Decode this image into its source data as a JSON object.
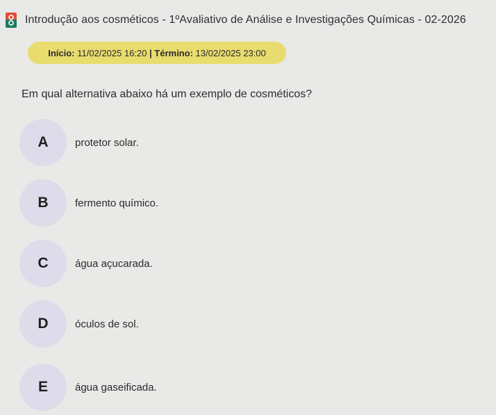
{
  "header": {
    "title": "Introdução aos cosméticos - 1ºAvaliativo de Análise e Investigações Químicas - 02-2026",
    "icon": "app-logo-icon"
  },
  "schedule": {
    "start_label": "Início:",
    "start_value": "11/02/2025 16:20",
    "separator": "|",
    "end_label": "Término:",
    "end_value": "13/02/2025 23:00"
  },
  "question": {
    "text": "Em qual alternativa abaixo há um exemplo de cosméticos?"
  },
  "options": [
    {
      "letter": "A",
      "text": "protetor solar."
    },
    {
      "letter": "B",
      "text": "fermento químico."
    },
    {
      "letter": "C",
      "text": "água açucarada."
    },
    {
      "letter": "D",
      "text": "óculos de sol."
    },
    {
      "letter": "E",
      "text": "água gaseificada."
    }
  ],
  "colors": {
    "background": "#e9e9e7",
    "pill": "#e8dc6e",
    "option_circle": "#dedcea",
    "logo_top": "#e24d3b",
    "logo_bottom": "#1e7b5e"
  }
}
